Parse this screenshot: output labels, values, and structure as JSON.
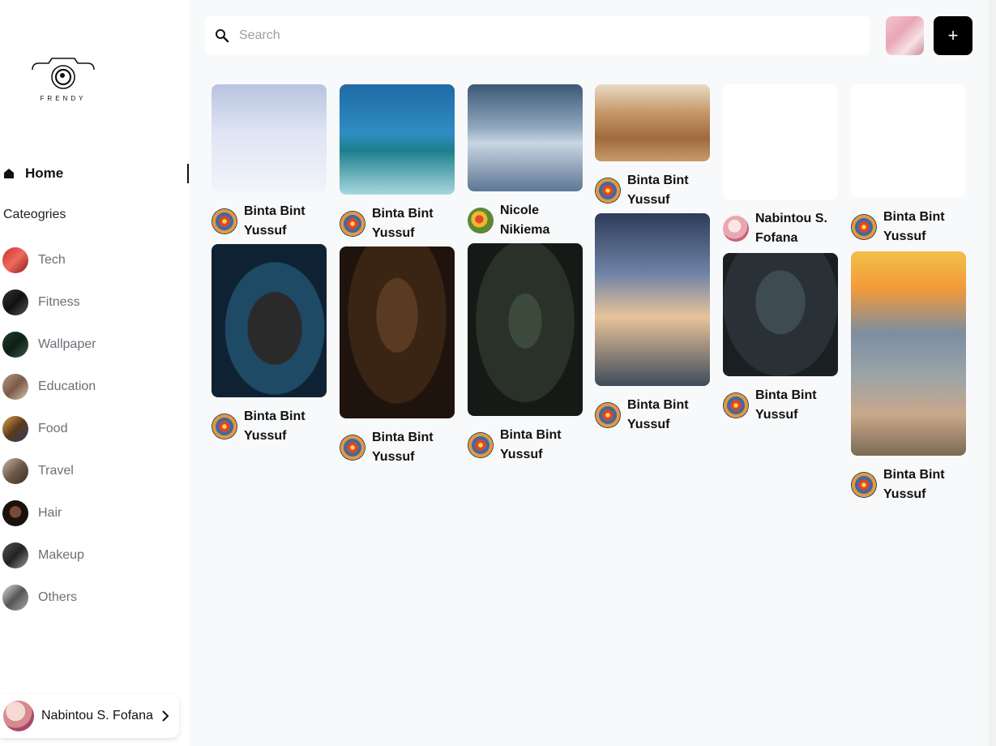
{
  "brand": {
    "name": "FRENDY"
  },
  "nav": {
    "home_label": "Home"
  },
  "categories": {
    "title": "Cateogries",
    "items": [
      {
        "label": "Tech",
        "thumb": "linear-gradient(135deg,#c9302c,#f06a5f 50%,#8a1c1c)"
      },
      {
        "label": "Fitness",
        "thumb": "linear-gradient(135deg,#333,#111 50%,#555)"
      },
      {
        "label": "Wallpaper",
        "thumb": "linear-gradient(135deg,#1e3d2b,#0f1f17 50%,#3a5a45)"
      },
      {
        "label": "Education",
        "thumb": "linear-gradient(135deg,#b59a84,#7a5a48 50%,#d8c4b4)"
      },
      {
        "label": "Food",
        "thumb": "linear-gradient(135deg,#e0a448,#5c3a1c 50%,#2b3e66)"
      },
      {
        "label": "Travel",
        "thumb": "linear-gradient(135deg,#c9b8a8,#6f5a48 50%,#3a2e26)"
      },
      {
        "label": "Hair",
        "thumb": "radial-gradient(circle at 50% 45%,#7b4a34 0 30%,#1a120e 31% 100%)"
      },
      {
        "label": "Makeup",
        "thumb": "linear-gradient(135deg,#555,#222 50%,#999)"
      },
      {
        "label": "Others",
        "thumb": "linear-gradient(135deg,#ddd,#555 50%,#aaa)"
      }
    ]
  },
  "search": {
    "placeholder": "Search",
    "value": ""
  },
  "actions": {
    "add_label": "+"
  },
  "user": {
    "name": "Nabintou S. Fofana"
  },
  "pins": [
    {
      "author": "Binta Bint Yussuf",
      "avatar": "mandala",
      "image": "arctic-fox",
      "bg": "linear-gradient(180deg,#b8c3e0 0%,#dfe5f3 45%,#f2f4fa 100%)"
    },
    {
      "author": "Binta Bint Yussuf",
      "avatar": "mandala",
      "image": "woman-gold-bodypaint",
      "bg": "radial-gradient(ellipse at 55% 55%,#2b2a2a 0 30%,#1e4a66 31% 55%,#0e2233 56% 100%)"
    },
    {
      "author": "Binta Bint Yussuf",
      "avatar": "mandala",
      "image": "ice-cream-cone",
      "bg": "linear-gradient(180deg,#1f6aa6 0%,#2f8dc2 45%,#1d7f8c 60%,#a8d7df 100%)"
    },
    {
      "author": "Binta Bint Yussuf",
      "avatar": "mandala",
      "image": "woman-pearls",
      "bg": "radial-gradient(ellipse at 50% 40%,#5a3b22 0 25%,#3a2414 26% 60%,#1e140d 61% 100%)"
    },
    {
      "author": "Nicole Nikiema",
      "avatar": "flower",
      "image": "ice-crystal",
      "bg": "linear-gradient(180deg,#3d5878 0%,#8fa6bd 40%,#c9d6e2 55%,#5d7694 100%)"
    },
    {
      "author": "Binta Bint Yussuf",
      "avatar": "mandala",
      "image": "woman-headwrap",
      "bg": "radial-gradient(ellipse at 50% 45%,#3b4a3a 0 20%,#2a3128 21% 60%,#161a16 61% 100%)"
    },
    {
      "author": "Binta Bint Yussuf",
      "avatar": "mandala",
      "image": "macarons",
      "bg": "linear-gradient(180deg,#e8dcc5 0%,#c89a6a 35%,#a06a3c 70%,#c79b6a 100%)"
    },
    {
      "author": "Binta Bint Yussuf",
      "avatar": "mandala",
      "image": "woman-hijab-sunset",
      "bg": "linear-gradient(180deg,#2e3c5a 0%,#6f83a6 35%,#e8c39a 60%,#3e4b5a 100%)"
    },
    {
      "author": "Nabintou S. Fofana",
      "avatar": "pink",
      "image": "woman-at-desk",
      "bg": "linear-gradient(180deg,#ffffff 0%,#ffffff 100%)"
    },
    {
      "author": "Binta Bint Yussuf",
      "avatar": "mandala",
      "image": "woman-teal-hair",
      "bg": "radial-gradient(ellipse at 50% 40%,#3f4b52 0 30%,#2a3136 31% 70%,#1a1f22 71% 100%)"
    },
    {
      "author": "Binta Bint Yussuf",
      "avatar": "mandala",
      "image": "minion",
      "bg": "linear-gradient(180deg,#ffffff 0%,#ffffff 100%)"
    },
    {
      "author": "Binta Bint Yussuf",
      "avatar": "mandala",
      "image": "stacked-stones-sunset",
      "bg": "linear-gradient(180deg,#f2c04a 0%,#f39a3a 18%,#7c8ea0 40%,#9aa3a8 60%,#c9a88a 80%,#7a6a55 100%)"
    }
  ],
  "colors": {
    "accent": "#000000",
    "page_bg": "#f8f9fb",
    "muted_text": "#6b6f76"
  },
  "icons": [
    "camera-logo-icon",
    "home-icon",
    "search-icon",
    "chevron-right-icon",
    "plus-icon"
  ]
}
